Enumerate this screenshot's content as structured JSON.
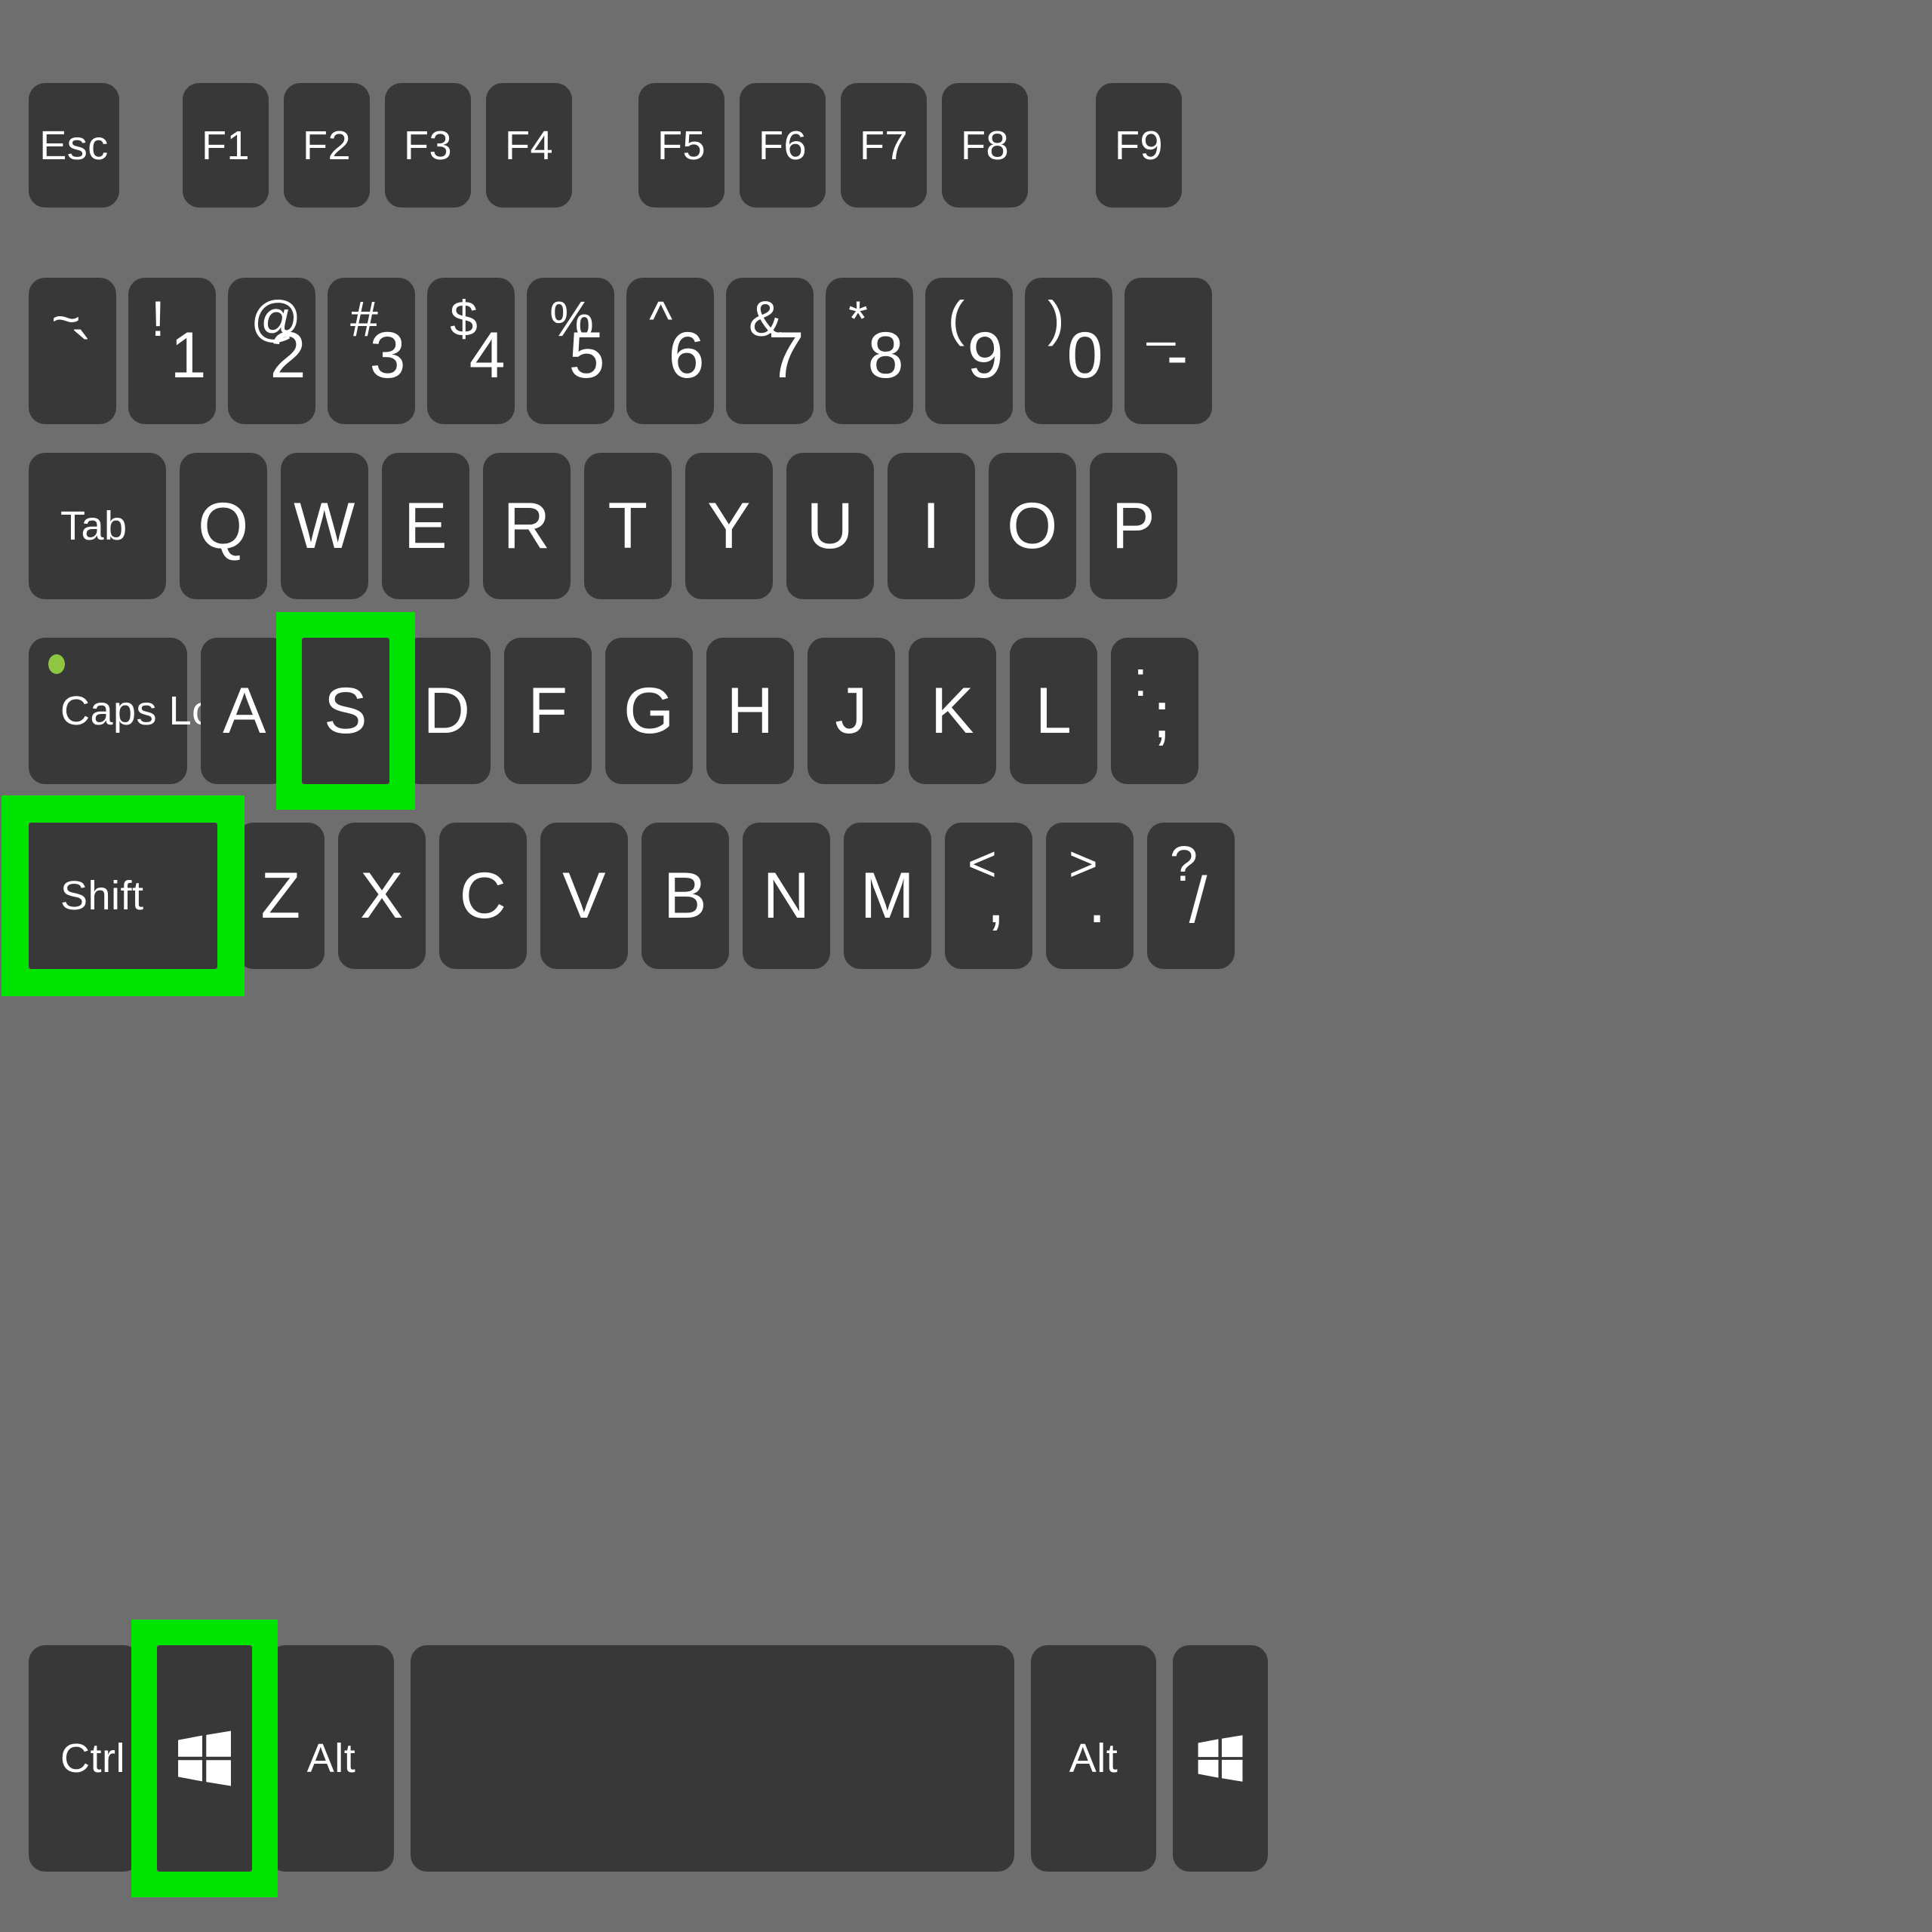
{
  "illustration": {
    "subject": "laptop-keyboard",
    "shortcut_highlighted": "Windows + Shift + S",
    "colors": {
      "background": "#6e6e6e",
      "key_face": "#383838",
      "legend": "#ffffff",
      "highlight_green": "#00e400",
      "capslock_led": "#8ec641"
    }
  },
  "rows": {
    "function_row": [
      {
        "id": "esc",
        "label": "Esc"
      },
      {
        "id": "f1",
        "label": "F1"
      },
      {
        "id": "f2",
        "label": "F2"
      },
      {
        "id": "f3",
        "label": "F3"
      },
      {
        "id": "f4",
        "label": "F4"
      },
      {
        "id": "f5",
        "label": "F5"
      },
      {
        "id": "f6",
        "label": "F6"
      },
      {
        "id": "f7",
        "label": "F7"
      },
      {
        "id": "f8",
        "label": "F8"
      },
      {
        "id": "f9",
        "label": "F9"
      }
    ],
    "number_row": [
      {
        "id": "backtick",
        "top": "~",
        "bottom": "`"
      },
      {
        "id": "one",
        "top": "!",
        "bottom": "1"
      },
      {
        "id": "two",
        "top": "@",
        "bottom": "2"
      },
      {
        "id": "three",
        "top": "#",
        "bottom": "3"
      },
      {
        "id": "four",
        "top": "$",
        "bottom": "4"
      },
      {
        "id": "five",
        "top": "%",
        "bottom": "5"
      },
      {
        "id": "six",
        "top": "^",
        "bottom": "6"
      },
      {
        "id": "seven",
        "top": "&",
        "bottom": "7"
      },
      {
        "id": "eight",
        "top": "*",
        "bottom": "8"
      },
      {
        "id": "nine",
        "top": "(",
        "bottom": "9"
      },
      {
        "id": "zero",
        "top": ")",
        "bottom": "0"
      },
      {
        "id": "minus",
        "top": "_",
        "bottom": "-"
      }
    ],
    "top_letter_row": {
      "modifier": {
        "id": "tab",
        "label": "Tab"
      },
      "letters": [
        "Q",
        "W",
        "E",
        "R",
        "T",
        "Y",
        "U",
        "I",
        "O",
        "P"
      ]
    },
    "home_row": {
      "modifier": {
        "id": "capslock",
        "label": "Caps Lock"
      },
      "letters": [
        "A",
        "S",
        "D",
        "F",
        "G",
        "H",
        "J",
        "K",
        "L"
      ],
      "punctuation": {
        "id": "semicolon",
        "top": ":",
        "bottom": ";"
      }
    },
    "bottom_letter_row": {
      "modifier": {
        "id": "shift",
        "label": "Shift"
      },
      "letters": [
        "Z",
        "X",
        "C",
        "V",
        "B",
        "N",
        "M"
      ],
      "punctuation": [
        {
          "id": "comma",
          "top": "<",
          "bottom": ","
        },
        {
          "id": "period",
          "top": ">",
          "bottom": "."
        },
        {
          "id": "slash",
          "top": "?",
          "bottom": "/"
        }
      ]
    },
    "modifier_row": [
      {
        "id": "ctrl",
        "label": "Ctrl",
        "icon": ""
      },
      {
        "id": "win-left",
        "label": "",
        "icon": "windows-logo"
      },
      {
        "id": "alt-left",
        "label": "Alt",
        "icon": ""
      },
      {
        "id": "space",
        "label": "",
        "icon": ""
      },
      {
        "id": "alt-right",
        "label": "Alt",
        "icon": ""
      },
      {
        "id": "win-right",
        "label": "",
        "icon": "windows-logo"
      }
    ]
  },
  "highlights": [
    {
      "id": "highlight-s",
      "target": "S key",
      "color": "#00e400"
    },
    {
      "id": "highlight-shift",
      "target": "Shift key",
      "color": "#00e400"
    },
    {
      "id": "highlight-win",
      "target": "Windows key",
      "color": "#00e400"
    }
  ]
}
